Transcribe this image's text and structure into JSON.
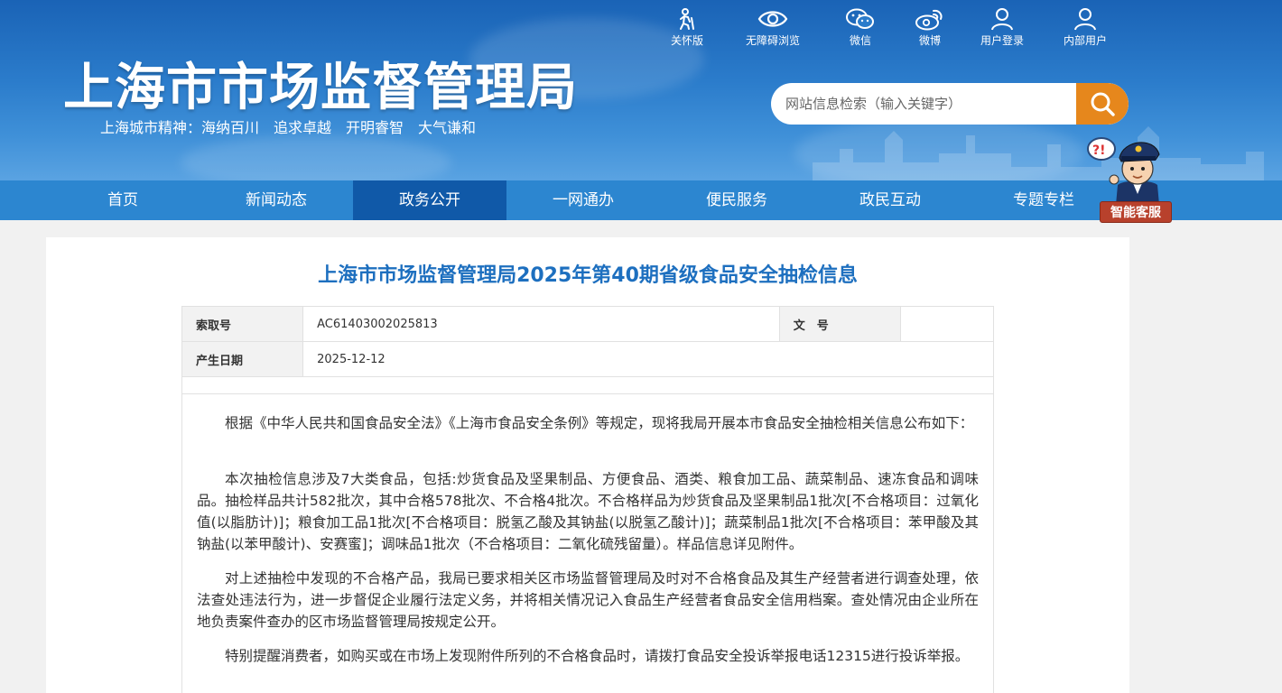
{
  "header": {
    "title": "上海市市场监督管理局",
    "slogan": "上海城市精神：海纳百川　追求卓越　开明睿智　大气谦和",
    "top_links": [
      {
        "label": "关怀版",
        "icon": "elderly-icon"
      },
      {
        "label": "无障碍浏览",
        "icon": "eye-icon"
      },
      {
        "label": "微信",
        "icon": "wechat-icon"
      },
      {
        "label": "微博",
        "icon": "weibo-icon"
      },
      {
        "label": "用户登录",
        "icon": "user-icon"
      },
      {
        "label": "内部用户",
        "icon": "user-icon"
      }
    ],
    "search": {
      "placeholder": "网站信息检索（输入关键字）",
      "button_icon": "search-icon"
    }
  },
  "nav": {
    "items": [
      "首页",
      "新闻动态",
      "政务公开",
      "一网通办",
      "便民服务",
      "政民互动",
      "专题专栏"
    ],
    "active_index": 2
  },
  "customer_service": {
    "label": "智能客服",
    "icon": "police-avatar-icon"
  },
  "article": {
    "title": "上海市市场监督管理局2025年第40期省级食品安全抽检信息",
    "meta": {
      "index_label": "索取号",
      "index_value": "AC61403002025813",
      "doc_label": "文　号",
      "doc_value": "",
      "date_label": "产生日期",
      "date_value": "2025-12-12"
    },
    "paragraphs": [
      "根据《中华人民共和国食品安全法》《上海市食品安全条例》等规定，现将我局开展本市食品安全抽检相关信息公布如下：",
      "本次抽检信息涉及7大类食品，包括:炒货食品及坚果制品、方便食品、酒类、粮食加工品、蔬菜制品、速冻食品和调味品。抽检样品共计582批次，其中合格578批次、不合格4批次。不合格样品为炒货食品及坚果制品1批次[不合格项目：过氧化值(以脂肪计)]；粮食加工品1批次[不合格项目：脱氢乙酸及其钠盐(以脱氢乙酸计)]；蔬菜制品1批次[不合格项目：苯甲酸及其钠盐(以苯甲酸计)、安赛蜜]；调味品1批次（不合格项目：二氧化硫残留量）。样品信息详见附件。",
      "对上述抽检中发现的不合格产品，我局已要求相关区市场监督管理局及时对不合格食品及其生产经营者进行调查处理，依法查处违法行为，进一步督促企业履行法定义务，并将相关情况记入食品生产经营者食品安全信用档案。查处情况由企业所在地负责案件查办的区市场监督管理局按规定公开。",
      "特别提醒消费者，如购买或在市场上发现附件所列的不合格食品时，请拨打食品安全投诉举报电话12315进行投诉举报。"
    ]
  },
  "colors": {
    "header_blue": "#1a63b6",
    "nav_blue": "#2c86d0",
    "nav_active": "#1059a8",
    "title_blue": "#1d6fbf",
    "search_orange": "#e6871c"
  }
}
